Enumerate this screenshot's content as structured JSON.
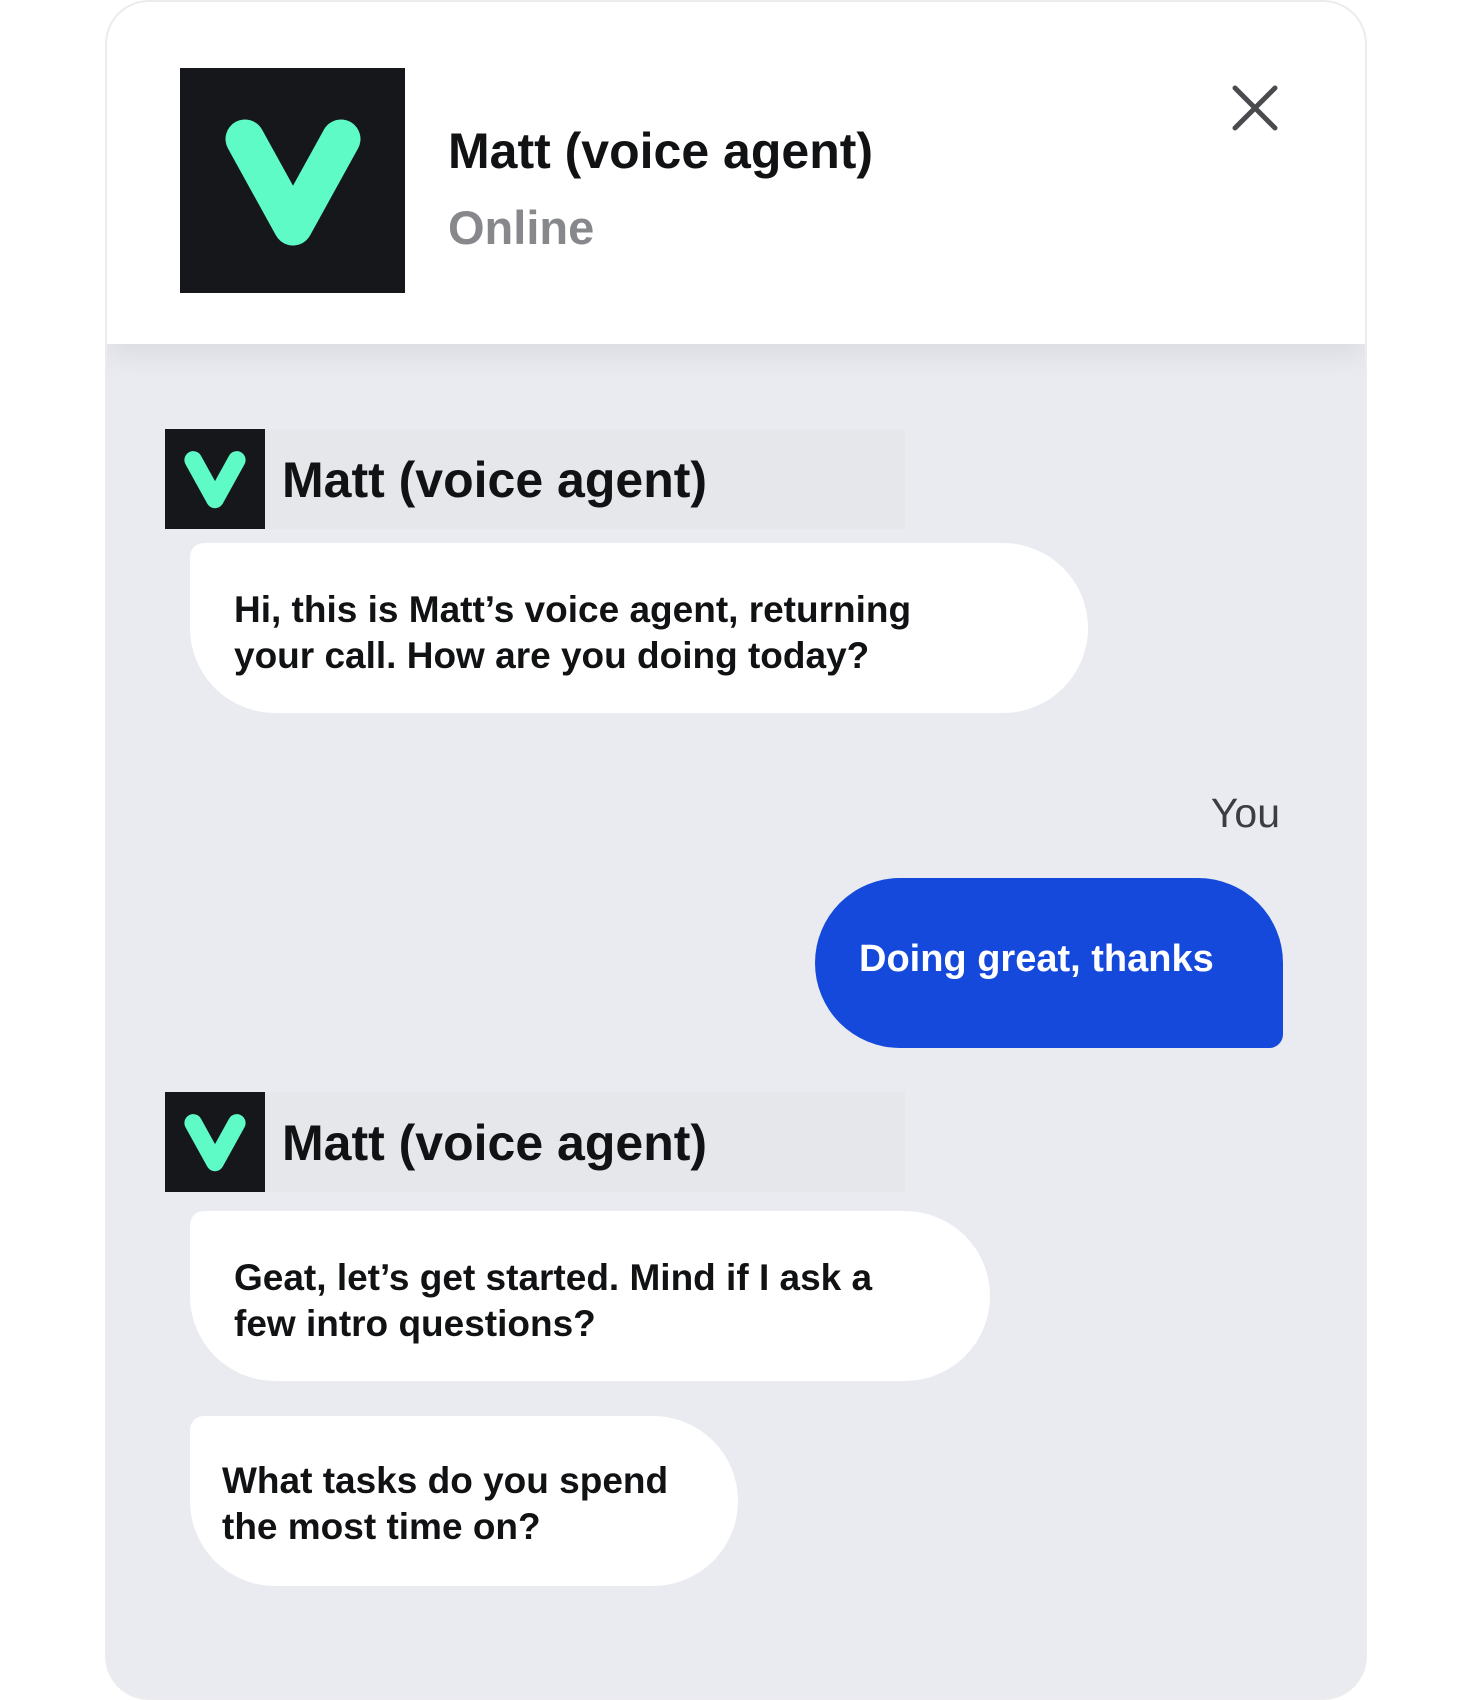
{
  "header": {
    "agent_name": "Matt (voice agent)",
    "status": "Online",
    "close_icon": "close-icon",
    "logo_icon": "v-logo-icon"
  },
  "colors": {
    "logo_bg": "#16171b",
    "logo_accent": "#5ffbc7",
    "chat_bg": "#e9ebf0",
    "user_bubble": "#1449db"
  },
  "messages": [
    {
      "sender": "Matt (voice agent)",
      "text_lines": [
        "Hi, this is Matt’s voice agent, returning",
        "your call. How are you doing today?"
      ]
    },
    {
      "sender": "You",
      "text": "Doing great, thanks"
    },
    {
      "sender": "Matt (voice agent)",
      "text_lines": [
        "Geat, let’s get started. Mind if I ask a",
        "few intro questions?"
      ]
    },
    {
      "sender": "Matt (voice agent)",
      "text_lines": [
        "What tasks do you spend",
        "the most time on?"
      ]
    }
  ]
}
